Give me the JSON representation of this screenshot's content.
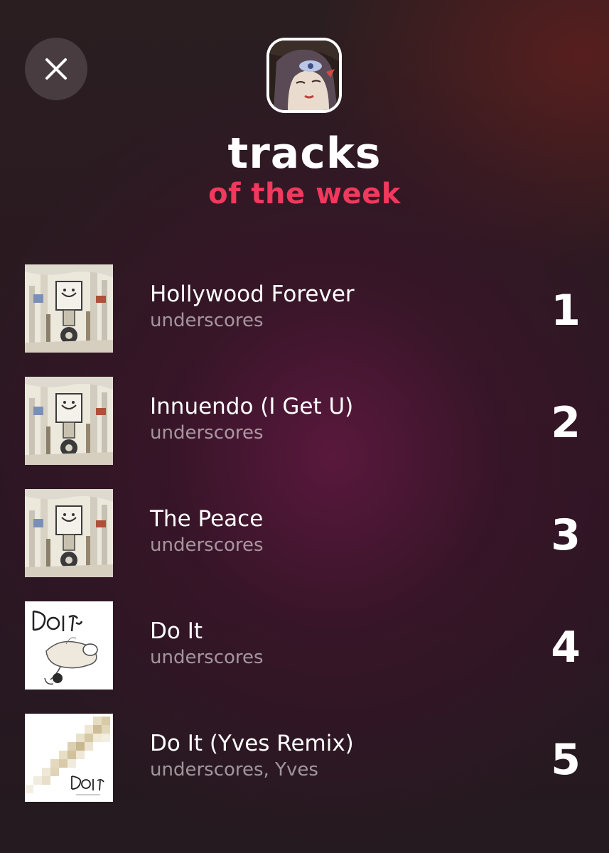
{
  "header": {
    "close_icon": "close-icon",
    "title": "tracks",
    "subtitle": "of the week",
    "accent_color": "#ef3a5d"
  },
  "tracks": [
    {
      "rank": "1",
      "title": "Hollywood Forever",
      "artist": "underscores",
      "cover": "album-art-cover"
    },
    {
      "rank": "2",
      "title": "Innuendo (I Get U)",
      "artist": "underscores",
      "cover": "album-art-cover"
    },
    {
      "rank": "3",
      "title": "The Peace",
      "artist": "underscores",
      "cover": "album-art-cover"
    },
    {
      "rank": "4",
      "title": "Do It",
      "artist": "underscores",
      "cover": "do-it-sketch-cover"
    },
    {
      "rank": "5",
      "title": "Do It (Yves Remix)",
      "artist": "underscores, Yves",
      "cover": "do-it-remix-pixel-cover"
    }
  ]
}
